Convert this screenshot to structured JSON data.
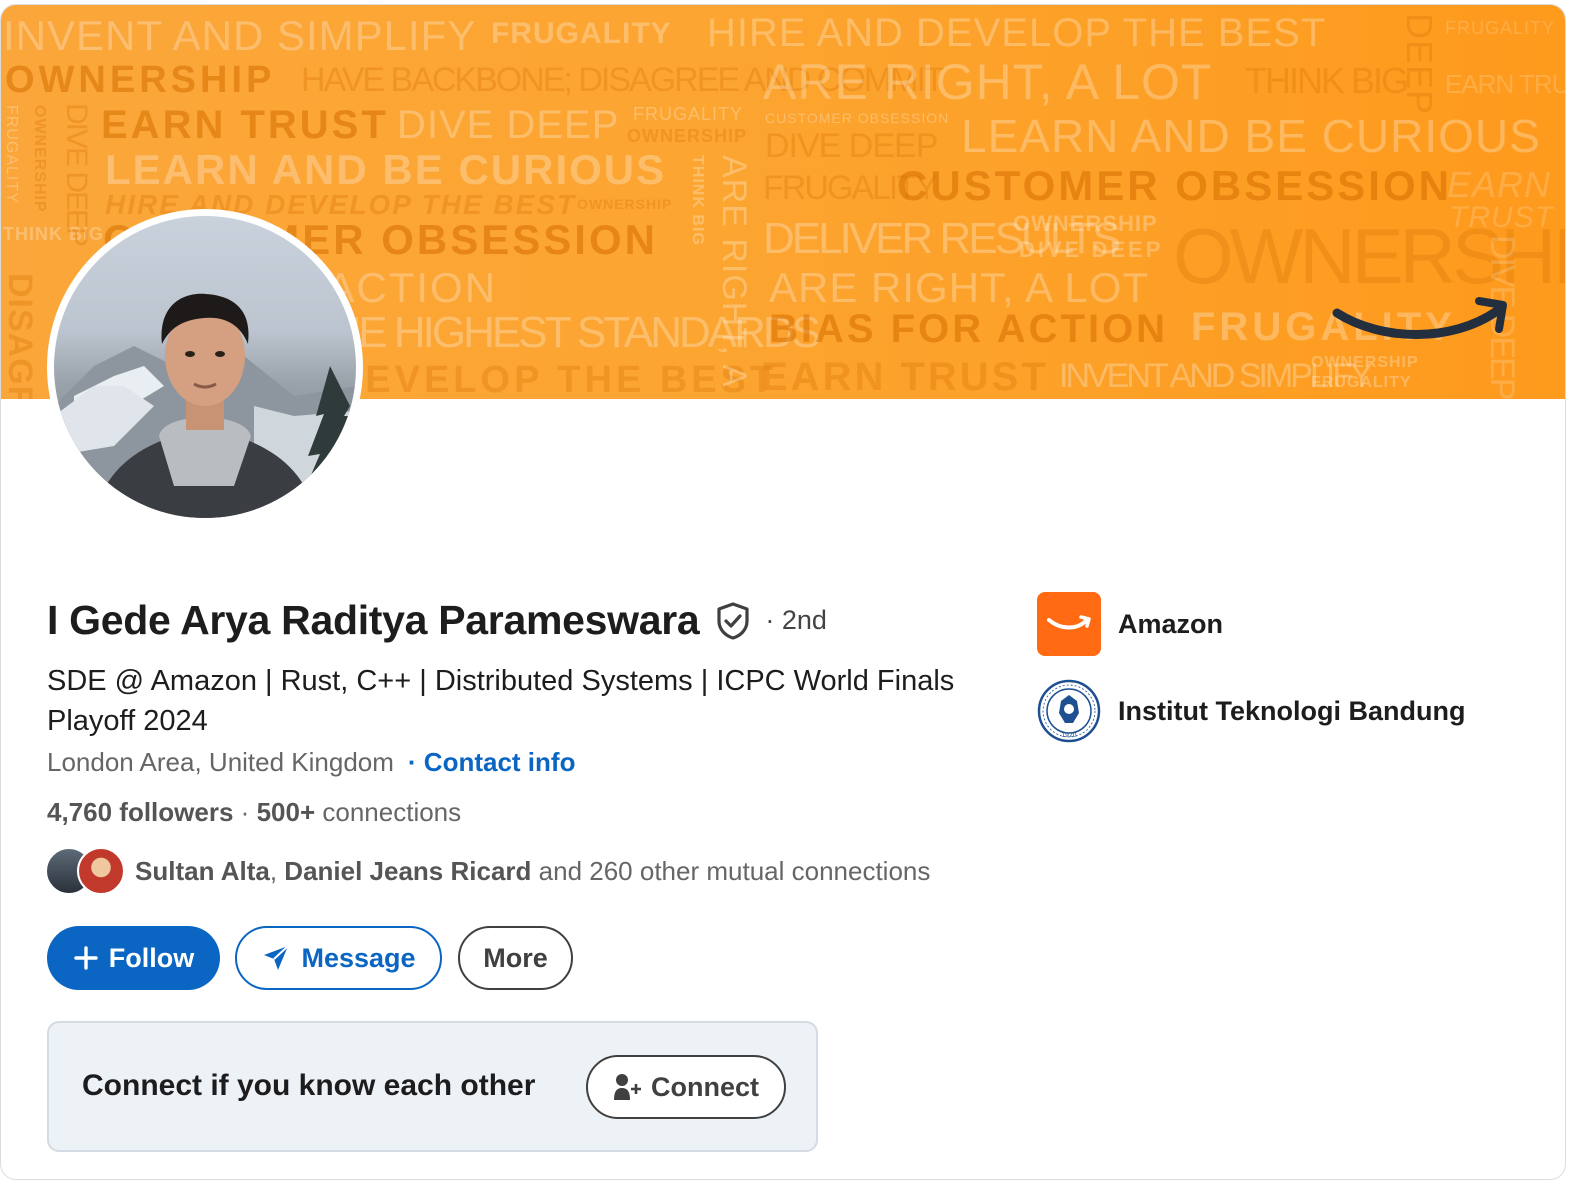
{
  "banner": {
    "words": [
      "INVENT AND SIMPLIFY",
      "FRUGALITY",
      "HIRE AND DEVELOP THE BEST",
      "FRUGALITY",
      "OWNERSHIP",
      "HAVE BACKBONE; DISAGREE AND COMMIT",
      "ARE RIGHT, A LOT",
      "THINK BIG",
      "EARN TRUST",
      "EARN TRUST",
      "DIVE DEEP",
      "FRUGALITY",
      "OWNERSHIP",
      "CUSTOMER OBSESSION",
      "DIVE DEEP",
      "LEARN AND BE CURIOUS",
      "LEARN AND BE CURIOUS",
      "FRUGALITY",
      "CUSTOMER OBSESSION",
      "EARN",
      "HIRE AND DEVELOP THE BEST",
      "OWNERSHIP",
      "TRUST",
      "THINK BIG",
      "CUSTOMER OBSESSION",
      "DELIVER RESULTS",
      "OWNERSHIP",
      "DIVE DEEP",
      "OWNERSHIP",
      "BIAS FOR ACTION",
      "ARE RIGHT, A LOT",
      "INSIST ON THE HIGHEST STANDARDS",
      "BIAS FOR ACTION",
      "FRUGALITY",
      "HIRE AND DEVELOP THE BEST",
      "EARN TRUST",
      "INVENT AND SIMPLIFY",
      "OWNERSHIP",
      "FRUGALITY",
      "DIVE DEEP",
      "OWNERSHIP",
      "FRUGALITY",
      "THINK BIG",
      "ARE RIGHT, A LOT",
      "DEEP",
      "DIVE DEEP",
      "DISAGREE"
    ]
  },
  "profile": {
    "name": "I Gede Arya Raditya Parameswara",
    "degree": "· 2nd",
    "headline": "SDE @ Amazon | Rust, C++ | Distributed Systems | ICPC World Finals Playoff 2024",
    "location": "London Area, United Kingdom",
    "contact_label": "· Contact info",
    "followers": "4,760 followers",
    "separator": "·",
    "connections_count": "500+",
    "connections_label": "connections",
    "mutual_names_1": "Sultan Alta",
    "mutual_comma": ",",
    "mutual_names_2": "Daniel Jeans Ricard",
    "mutual_rest": "and 260 other mutual connections"
  },
  "actions": {
    "follow_label": "Follow",
    "message_label": "Message",
    "more_label": "More"
  },
  "connect_box": {
    "text": "Connect if you know each other",
    "button_label": "Connect"
  },
  "orgs": [
    {
      "name": "Amazon"
    },
    {
      "name": "Institut Teknologi Bandung",
      "seal_year": "1920"
    }
  ],
  "colors": {
    "brand_blue": "#0a66c2",
    "banner_orange": "#fca531",
    "amazon_orange": "#ff6a13"
  }
}
